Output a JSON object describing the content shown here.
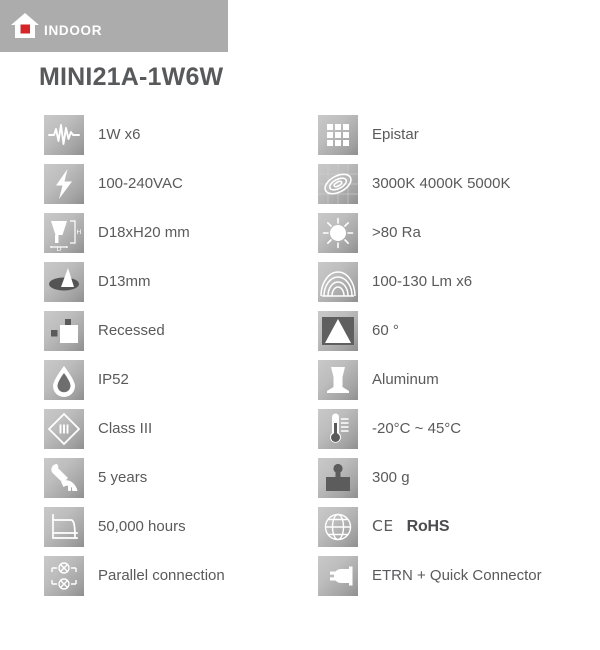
{
  "banner": {
    "label": "INDOOR",
    "icon": "house-icon",
    "background_color": "#adacac",
    "accent_color": "#d42527"
  },
  "product": {
    "title": "MINI21A-1W6W"
  },
  "specs": {
    "left_column": [
      {
        "icon": "power-waveform-icon",
        "label": "1W x6"
      },
      {
        "icon": "voltage-bolt-icon",
        "label": "100-240VAC"
      },
      {
        "icon": "dimensions-icon",
        "label": "D18xH20 mm"
      },
      {
        "icon": "cutout-diameter-icon",
        "label": "D13mm"
      },
      {
        "icon": "recessed-mounting-icon",
        "label": "Recessed"
      },
      {
        "icon": "ip-rating-droplet-icon",
        "label": "IP52"
      },
      {
        "icon": "safety-class-icon",
        "label": "Class III"
      },
      {
        "icon": "warranty-wrench-icon",
        "label": "5 years"
      },
      {
        "icon": "lifetime-graph-icon",
        "label": "50,000 hours"
      },
      {
        "icon": "parallel-circuit-icon",
        "label": "Parallel connection"
      }
    ],
    "right_column": [
      {
        "icon": "led-chip-grid-icon",
        "label": "Epistar"
      },
      {
        "icon": "color-temperature-icon",
        "label": "3000K 4000K 5000K"
      },
      {
        "icon": "color-rendering-sun-icon",
        "label": ">80 Ra"
      },
      {
        "icon": "luminous-flux-icon",
        "label": "100-130 Lm x6"
      },
      {
        "icon": "beam-angle-icon",
        "label": "60 °"
      },
      {
        "icon": "housing-material-icon",
        "label": "Aluminum"
      },
      {
        "icon": "temperature-range-icon",
        "label": "-20°C ~ 45°C"
      },
      {
        "icon": "weight-icon",
        "label": "300 g"
      },
      {
        "icon": "certification-globe-icon",
        "label": "CE RoHS",
        "ce": "CE",
        "rohs": "RoHS"
      },
      {
        "icon": "connector-plug-icon",
        "label": "ETRN + Quick Connector"
      }
    ]
  }
}
